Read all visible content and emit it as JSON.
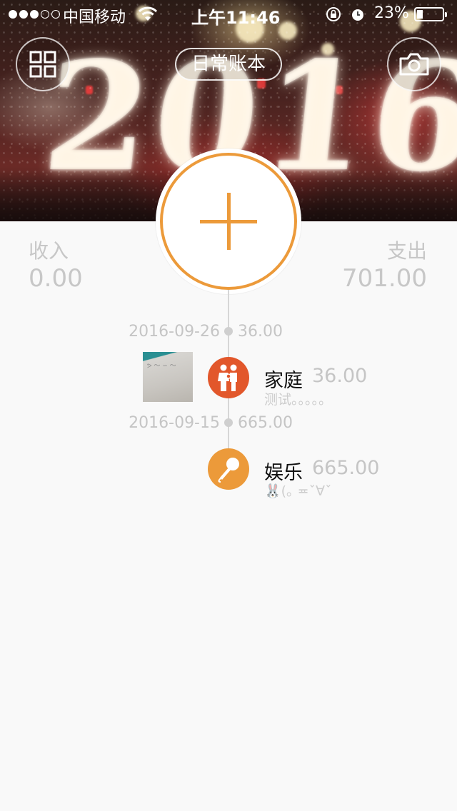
{
  "status_bar": {
    "carrier": "中国移动",
    "time": "上午11:46",
    "battery_percent": "23%",
    "battery_level": 0.23
  },
  "header": {
    "book_name": "日常账本",
    "photo_text": "2016"
  },
  "totals": {
    "income_label": "收入",
    "income_value": "0.00",
    "expense_label": "支出",
    "expense_value": "701.00"
  },
  "timeline": {
    "days": [
      {
        "date": "2016-09-26",
        "total": "36.00",
        "entries": [
          {
            "category": "家庭",
            "amount": "36.00",
            "note": "测试。。。。。",
            "icon": "family-icon",
            "color": "#e2572b",
            "has_photo": true
          }
        ]
      },
      {
        "date": "2016-09-15",
        "total": "665.00",
        "entries": [
          {
            "category": "娱乐",
            "amount": "665.00",
            "note": "🐰(｡ ≖ˇ∀ˇ",
            "icon": "microphone-icon",
            "color": "#ec9a3a",
            "has_photo": false
          }
        ]
      }
    ]
  },
  "colors": {
    "accent": "#ec9a3a",
    "family": "#e2572b",
    "muted_text": "#c5c5c5",
    "background": "#f9f9f9"
  }
}
